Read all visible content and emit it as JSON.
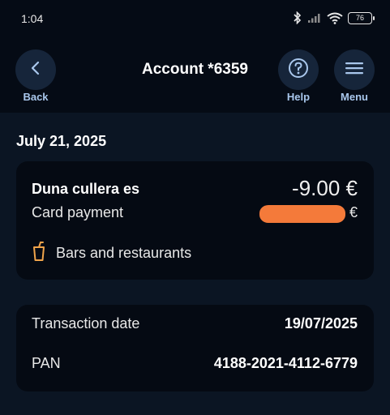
{
  "status_bar": {
    "time": "1:04",
    "battery": "76"
  },
  "header": {
    "title": "Account *6359",
    "back_label": "Back",
    "help_label": "Help",
    "menu_label": "Menu"
  },
  "date_heading": "July 21, 2025",
  "transaction": {
    "merchant": "Duna cullera es",
    "amount": "-9.00 €",
    "payment_type": "Card payment",
    "secondary_currency": "€",
    "category": "Bars and restaurants",
    "category_icon": "drink-cup-icon"
  },
  "details": {
    "rows": [
      {
        "label": "Transaction date",
        "value": "19/07/2025"
      },
      {
        "label": "PAN",
        "value": "4188-2021-4112-6779"
      }
    ]
  },
  "colors": {
    "background": "#0b1523",
    "header_bg": "#050b15",
    "card_bg": "#050a13",
    "accent": "#a9c7ec",
    "category_icon": "#f0a44b",
    "redaction": "#f47a3a"
  }
}
